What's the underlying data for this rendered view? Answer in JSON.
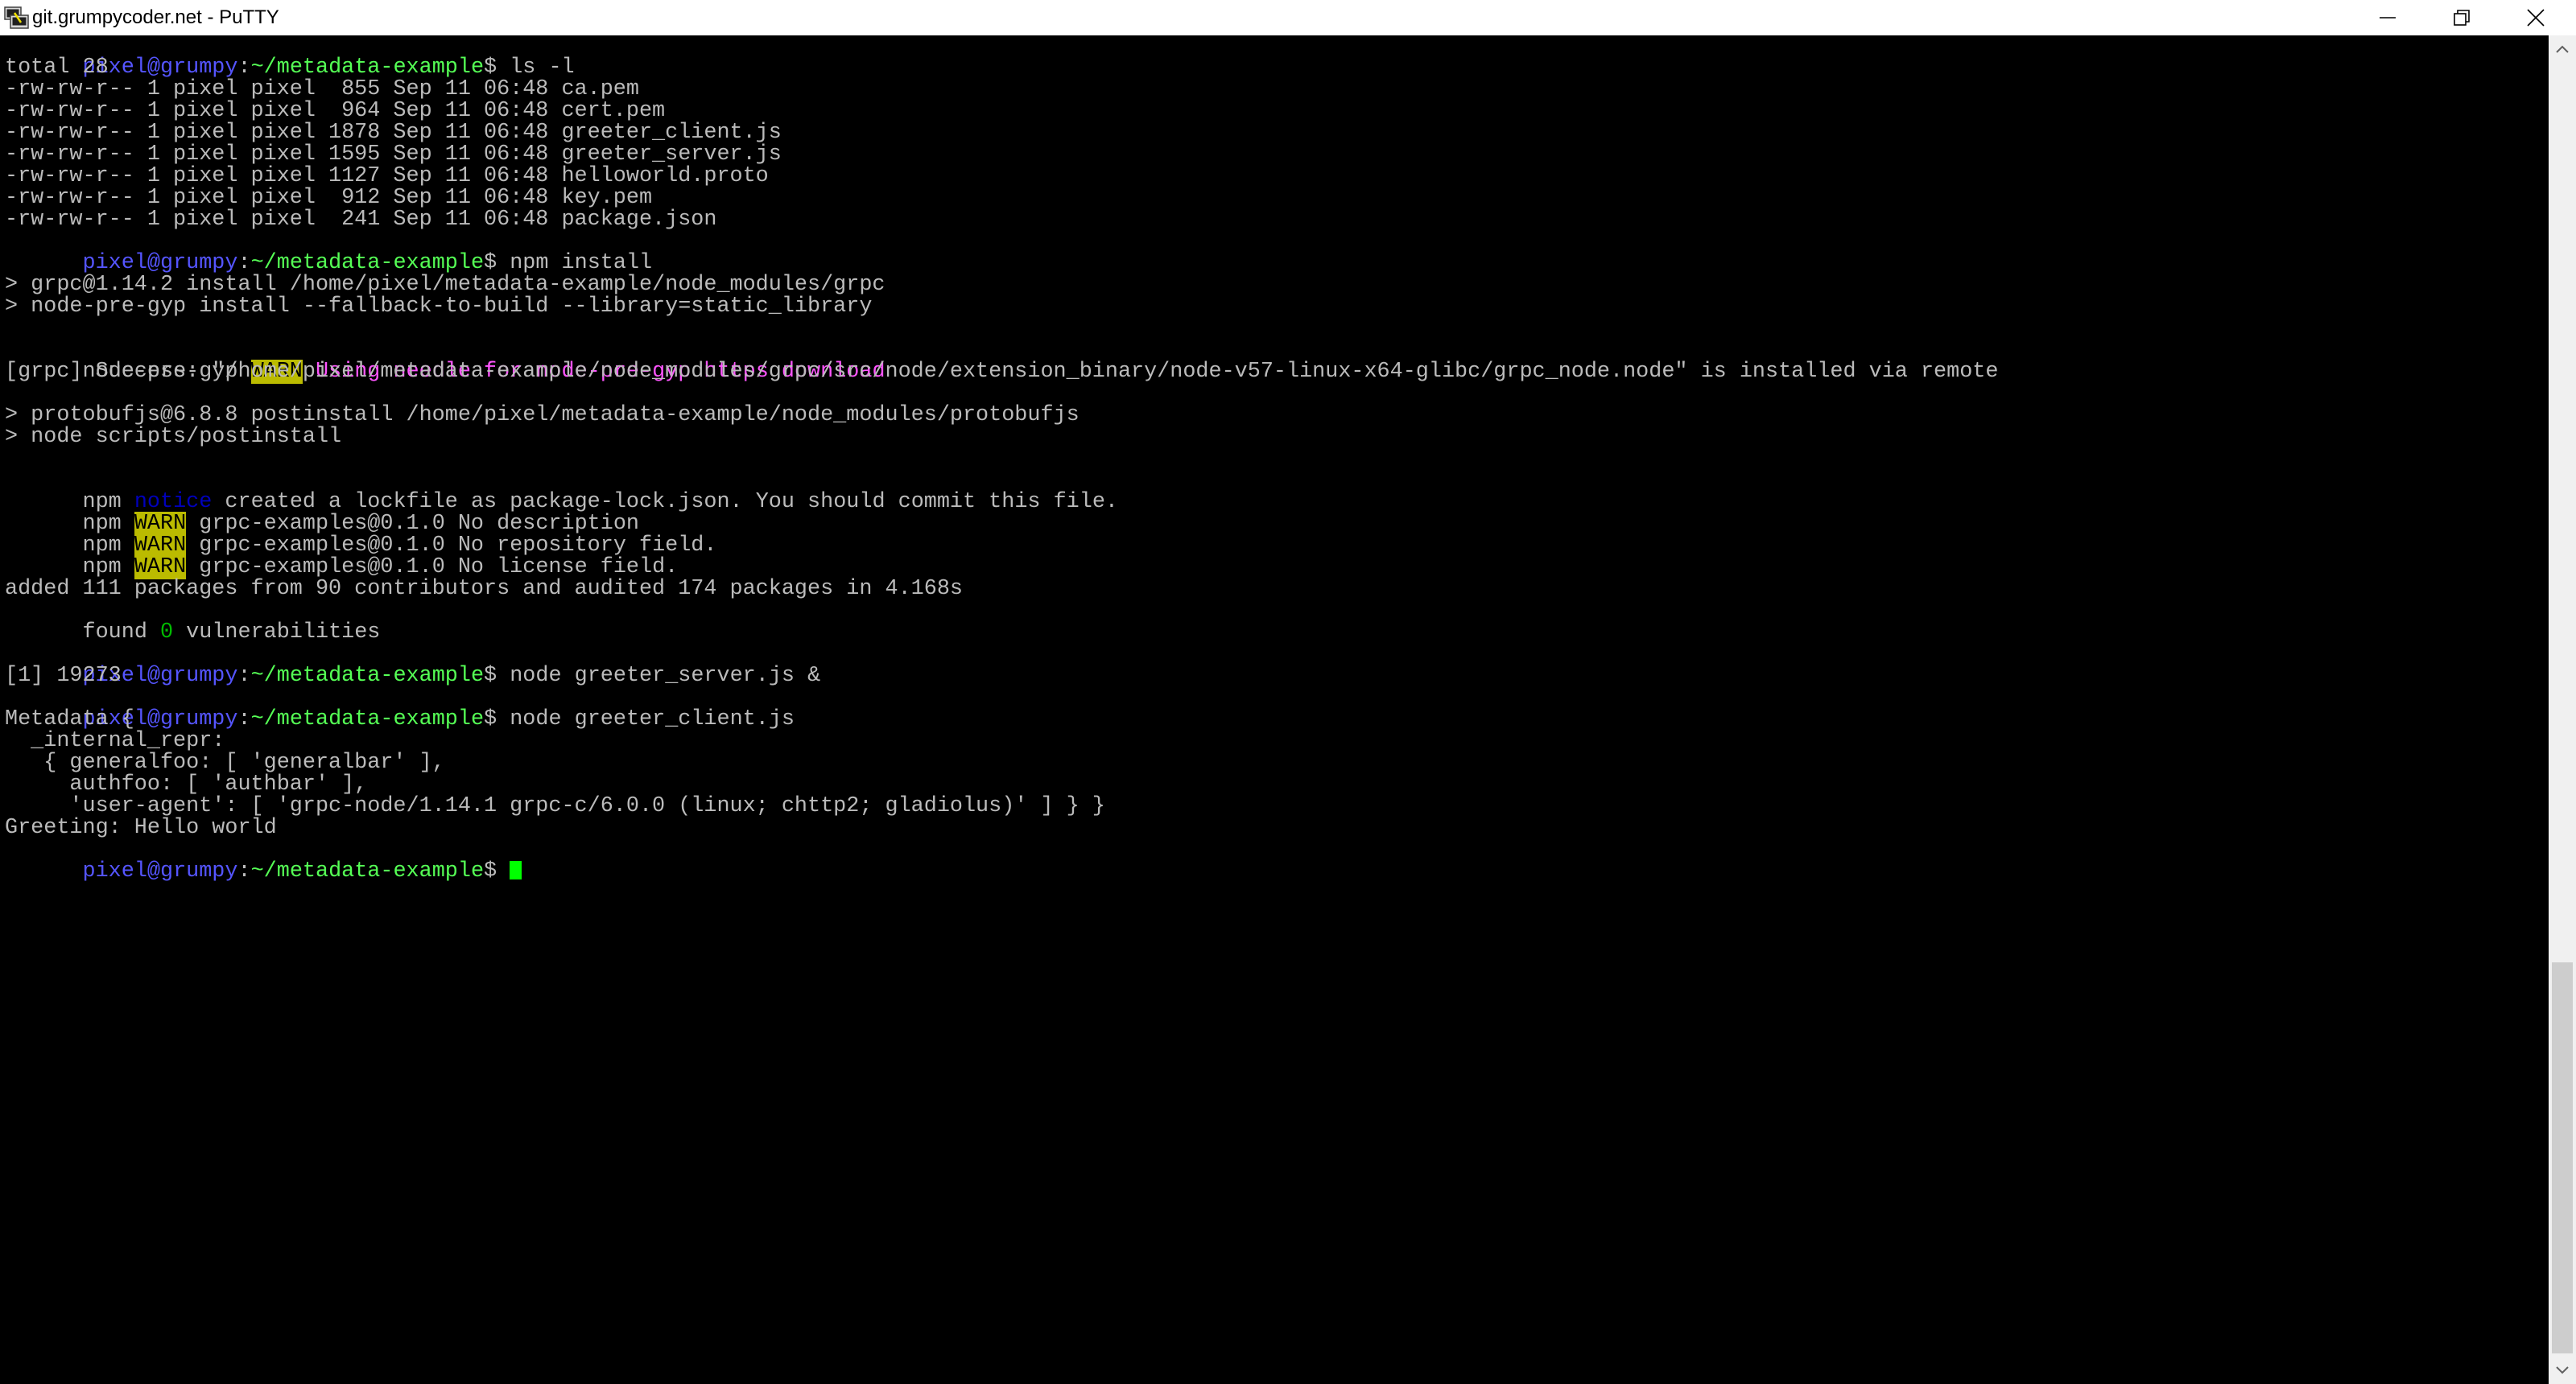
{
  "window": {
    "title": "git.grumpycoder.net - PuTTY"
  },
  "icons": {
    "app": "putty-icon",
    "minimize": "minimize-icon",
    "maximize": "restore-icon",
    "close": "close-icon"
  },
  "colors": {
    "prompt_user": "#5555ff",
    "prompt_path": "#55ff55",
    "text": "#bbbbbb",
    "warn_background": "#bbbb00",
    "magenta": "#ff55ff",
    "notice": "#0000bb",
    "cursor": "#00ff00"
  },
  "terminal": {
    "prompt": {
      "user": "pixel@grumpy",
      "path": "~/metadata-example",
      "symbol": "$ "
    },
    "cmd_ls": "ls -l",
    "total": "total 28",
    "files": [
      "-rw-rw-r-- 1 pixel pixel  855 Sep 11 06:48 ca.pem",
      "-rw-rw-r-- 1 pixel pixel  964 Sep 11 06:48 cert.pem",
      "-rw-rw-r-- 1 pixel pixel 1878 Sep 11 06:48 greeter_client.js",
      "-rw-rw-r-- 1 pixel pixel 1595 Sep 11 06:48 greeter_server.js",
      "-rw-rw-r-- 1 pixel pixel 1127 Sep 11 06:48 helloworld.proto",
      "-rw-rw-r-- 1 pixel pixel  912 Sep 11 06:48 key.pem",
      "-rw-rw-r-- 1 pixel pixel  241 Sep 11 06:48 package.json"
    ],
    "cmd_npm": "npm install",
    "grpc_install": "> grpc@1.14.2 install /home/pixel/metadata-example/node_modules/grpc",
    "npg_install": "> node-pre-gyp install --fallback-to-build --library=static_library",
    "npg_prefix": "node-pre-gyp ",
    "warn": "WARN",
    "npg_warn_msg": " Using needle for node-pre-gyp https download",
    "grpc_success": "[grpc] Success: \"/home/pixel/metadata-example/node_modules/grpc/src/node/extension_binary/node-v57-linux-x64-glibc/grpc_node.node\" is installed via remote",
    "protobuf_postinstall": "> protobufjs@6.8.8 postinstall /home/pixel/metadata-example/node_modules/protobufjs",
    "node_postinstall": "> node scripts/postinstall",
    "npm_prefix": "npm ",
    "notice": "notice",
    "notice_msg": " created a lockfile as package-lock.json. You should commit this file.",
    "warn_msgs": [
      " grpc-examples@0.1.0 No description",
      " grpc-examples@0.1.0 No repository field.",
      " grpc-examples@0.1.0 No license field."
    ],
    "added": "added 111 packages from 90 contributors and audited 174 packages in 4.168s",
    "found_prefix": "found ",
    "found_count": "0",
    "found_suffix": " vulnerabilities",
    "cmd_server": "node greeter_server.js &",
    "job": "[1] 19273",
    "cmd_client": "node greeter_client.js",
    "output": [
      "Metadata {",
      "  _internal_repr:",
      "   { generalfoo: [ 'generalbar' ],",
      "     authfoo: [ 'authbar' ],",
      "     'user-agent': [ 'grpc-node/1.14.1 grpc-c/6.0.0 (linux; chttp2; gladiolus)' ] } }",
      "Greeting: Hello world"
    ]
  }
}
